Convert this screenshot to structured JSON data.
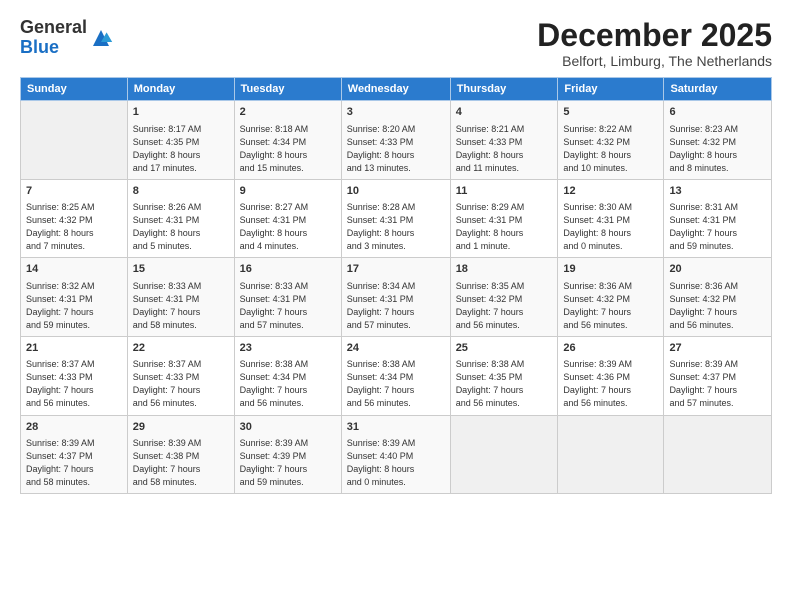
{
  "logo": {
    "general": "General",
    "blue": "Blue"
  },
  "header": {
    "month_title": "December 2025",
    "subtitle": "Belfort, Limburg, The Netherlands"
  },
  "days_of_week": [
    "Sunday",
    "Monday",
    "Tuesday",
    "Wednesday",
    "Thursday",
    "Friday",
    "Saturday"
  ],
  "weeks": [
    [
      {
        "day": "",
        "info": ""
      },
      {
        "day": "1",
        "info": "Sunrise: 8:17 AM\nSunset: 4:35 PM\nDaylight: 8 hours\nand 17 minutes."
      },
      {
        "day": "2",
        "info": "Sunrise: 8:18 AM\nSunset: 4:34 PM\nDaylight: 8 hours\nand 15 minutes."
      },
      {
        "day": "3",
        "info": "Sunrise: 8:20 AM\nSunset: 4:33 PM\nDaylight: 8 hours\nand 13 minutes."
      },
      {
        "day": "4",
        "info": "Sunrise: 8:21 AM\nSunset: 4:33 PM\nDaylight: 8 hours\nand 11 minutes."
      },
      {
        "day": "5",
        "info": "Sunrise: 8:22 AM\nSunset: 4:32 PM\nDaylight: 8 hours\nand 10 minutes."
      },
      {
        "day": "6",
        "info": "Sunrise: 8:23 AM\nSunset: 4:32 PM\nDaylight: 8 hours\nand 8 minutes."
      }
    ],
    [
      {
        "day": "7",
        "info": "Sunrise: 8:25 AM\nSunset: 4:32 PM\nDaylight: 8 hours\nand 7 minutes."
      },
      {
        "day": "8",
        "info": "Sunrise: 8:26 AM\nSunset: 4:31 PM\nDaylight: 8 hours\nand 5 minutes."
      },
      {
        "day": "9",
        "info": "Sunrise: 8:27 AM\nSunset: 4:31 PM\nDaylight: 8 hours\nand 4 minutes."
      },
      {
        "day": "10",
        "info": "Sunrise: 8:28 AM\nSunset: 4:31 PM\nDaylight: 8 hours\nand 3 minutes."
      },
      {
        "day": "11",
        "info": "Sunrise: 8:29 AM\nSunset: 4:31 PM\nDaylight: 8 hours\nand 1 minute."
      },
      {
        "day": "12",
        "info": "Sunrise: 8:30 AM\nSunset: 4:31 PM\nDaylight: 8 hours\nand 0 minutes."
      },
      {
        "day": "13",
        "info": "Sunrise: 8:31 AM\nSunset: 4:31 PM\nDaylight: 7 hours\nand 59 minutes."
      }
    ],
    [
      {
        "day": "14",
        "info": "Sunrise: 8:32 AM\nSunset: 4:31 PM\nDaylight: 7 hours\nand 59 minutes."
      },
      {
        "day": "15",
        "info": "Sunrise: 8:33 AM\nSunset: 4:31 PM\nDaylight: 7 hours\nand 58 minutes."
      },
      {
        "day": "16",
        "info": "Sunrise: 8:33 AM\nSunset: 4:31 PM\nDaylight: 7 hours\nand 57 minutes."
      },
      {
        "day": "17",
        "info": "Sunrise: 8:34 AM\nSunset: 4:31 PM\nDaylight: 7 hours\nand 57 minutes."
      },
      {
        "day": "18",
        "info": "Sunrise: 8:35 AM\nSunset: 4:32 PM\nDaylight: 7 hours\nand 56 minutes."
      },
      {
        "day": "19",
        "info": "Sunrise: 8:36 AM\nSunset: 4:32 PM\nDaylight: 7 hours\nand 56 minutes."
      },
      {
        "day": "20",
        "info": "Sunrise: 8:36 AM\nSunset: 4:32 PM\nDaylight: 7 hours\nand 56 minutes."
      }
    ],
    [
      {
        "day": "21",
        "info": "Sunrise: 8:37 AM\nSunset: 4:33 PM\nDaylight: 7 hours\nand 56 minutes."
      },
      {
        "day": "22",
        "info": "Sunrise: 8:37 AM\nSunset: 4:33 PM\nDaylight: 7 hours\nand 56 minutes."
      },
      {
        "day": "23",
        "info": "Sunrise: 8:38 AM\nSunset: 4:34 PM\nDaylight: 7 hours\nand 56 minutes."
      },
      {
        "day": "24",
        "info": "Sunrise: 8:38 AM\nSunset: 4:34 PM\nDaylight: 7 hours\nand 56 minutes."
      },
      {
        "day": "25",
        "info": "Sunrise: 8:38 AM\nSunset: 4:35 PM\nDaylight: 7 hours\nand 56 minutes."
      },
      {
        "day": "26",
        "info": "Sunrise: 8:39 AM\nSunset: 4:36 PM\nDaylight: 7 hours\nand 56 minutes."
      },
      {
        "day": "27",
        "info": "Sunrise: 8:39 AM\nSunset: 4:37 PM\nDaylight: 7 hours\nand 57 minutes."
      }
    ],
    [
      {
        "day": "28",
        "info": "Sunrise: 8:39 AM\nSunset: 4:37 PM\nDaylight: 7 hours\nand 58 minutes."
      },
      {
        "day": "29",
        "info": "Sunrise: 8:39 AM\nSunset: 4:38 PM\nDaylight: 7 hours\nand 58 minutes."
      },
      {
        "day": "30",
        "info": "Sunrise: 8:39 AM\nSunset: 4:39 PM\nDaylight: 7 hours\nand 59 minutes."
      },
      {
        "day": "31",
        "info": "Sunrise: 8:39 AM\nSunset: 4:40 PM\nDaylight: 8 hours\nand 0 minutes."
      },
      {
        "day": "",
        "info": ""
      },
      {
        "day": "",
        "info": ""
      },
      {
        "day": "",
        "info": ""
      }
    ]
  ]
}
